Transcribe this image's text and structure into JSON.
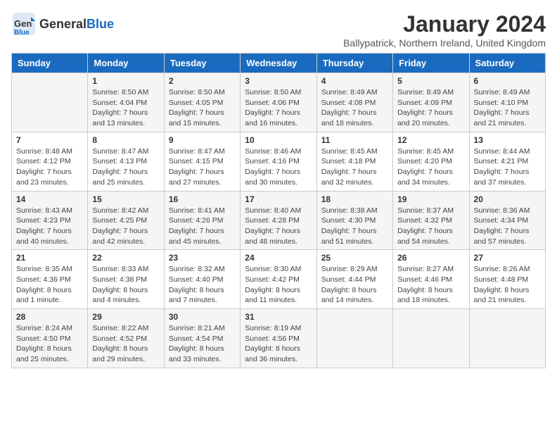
{
  "logo": {
    "general": "General",
    "blue": "Blue"
  },
  "title": "January 2024",
  "subtitle": "Ballypatrick, Northern Ireland, United Kingdom",
  "weekdays": [
    "Sunday",
    "Monday",
    "Tuesday",
    "Wednesday",
    "Thursday",
    "Friday",
    "Saturday"
  ],
  "weeks": [
    [
      {
        "day": null,
        "sunrise": null,
        "sunset": null,
        "daylight": null
      },
      {
        "day": "1",
        "sunrise": "Sunrise: 8:50 AM",
        "sunset": "Sunset: 4:04 PM",
        "daylight": "Daylight: 7 hours and 13 minutes."
      },
      {
        "day": "2",
        "sunrise": "Sunrise: 8:50 AM",
        "sunset": "Sunset: 4:05 PM",
        "daylight": "Daylight: 7 hours and 15 minutes."
      },
      {
        "day": "3",
        "sunrise": "Sunrise: 8:50 AM",
        "sunset": "Sunset: 4:06 PM",
        "daylight": "Daylight: 7 hours and 16 minutes."
      },
      {
        "day": "4",
        "sunrise": "Sunrise: 8:49 AM",
        "sunset": "Sunset: 4:08 PM",
        "daylight": "Daylight: 7 hours and 18 minutes."
      },
      {
        "day": "5",
        "sunrise": "Sunrise: 8:49 AM",
        "sunset": "Sunset: 4:09 PM",
        "daylight": "Daylight: 7 hours and 20 minutes."
      },
      {
        "day": "6",
        "sunrise": "Sunrise: 8:49 AM",
        "sunset": "Sunset: 4:10 PM",
        "daylight": "Daylight: 7 hours and 21 minutes."
      }
    ],
    [
      {
        "day": "7",
        "sunrise": "Sunrise: 8:48 AM",
        "sunset": "Sunset: 4:12 PM",
        "daylight": "Daylight: 7 hours and 23 minutes."
      },
      {
        "day": "8",
        "sunrise": "Sunrise: 8:47 AM",
        "sunset": "Sunset: 4:13 PM",
        "daylight": "Daylight: 7 hours and 25 minutes."
      },
      {
        "day": "9",
        "sunrise": "Sunrise: 8:47 AM",
        "sunset": "Sunset: 4:15 PM",
        "daylight": "Daylight: 7 hours and 27 minutes."
      },
      {
        "day": "10",
        "sunrise": "Sunrise: 8:46 AM",
        "sunset": "Sunset: 4:16 PM",
        "daylight": "Daylight: 7 hours and 30 minutes."
      },
      {
        "day": "11",
        "sunrise": "Sunrise: 8:45 AM",
        "sunset": "Sunset: 4:18 PM",
        "daylight": "Daylight: 7 hours and 32 minutes."
      },
      {
        "day": "12",
        "sunrise": "Sunrise: 8:45 AM",
        "sunset": "Sunset: 4:20 PM",
        "daylight": "Daylight: 7 hours and 34 minutes."
      },
      {
        "day": "13",
        "sunrise": "Sunrise: 8:44 AM",
        "sunset": "Sunset: 4:21 PM",
        "daylight": "Daylight: 7 hours and 37 minutes."
      }
    ],
    [
      {
        "day": "14",
        "sunrise": "Sunrise: 8:43 AM",
        "sunset": "Sunset: 4:23 PM",
        "daylight": "Daylight: 7 hours and 40 minutes."
      },
      {
        "day": "15",
        "sunrise": "Sunrise: 8:42 AM",
        "sunset": "Sunset: 4:25 PM",
        "daylight": "Daylight: 7 hours and 42 minutes."
      },
      {
        "day": "16",
        "sunrise": "Sunrise: 8:41 AM",
        "sunset": "Sunset: 4:26 PM",
        "daylight": "Daylight: 7 hours and 45 minutes."
      },
      {
        "day": "17",
        "sunrise": "Sunrise: 8:40 AM",
        "sunset": "Sunset: 4:28 PM",
        "daylight": "Daylight: 7 hours and 48 minutes."
      },
      {
        "day": "18",
        "sunrise": "Sunrise: 8:38 AM",
        "sunset": "Sunset: 4:30 PM",
        "daylight": "Daylight: 7 hours and 51 minutes."
      },
      {
        "day": "19",
        "sunrise": "Sunrise: 8:37 AM",
        "sunset": "Sunset: 4:32 PM",
        "daylight": "Daylight: 7 hours and 54 minutes."
      },
      {
        "day": "20",
        "sunrise": "Sunrise: 8:36 AM",
        "sunset": "Sunset: 4:34 PM",
        "daylight": "Daylight: 7 hours and 57 minutes."
      }
    ],
    [
      {
        "day": "21",
        "sunrise": "Sunrise: 8:35 AM",
        "sunset": "Sunset: 4:36 PM",
        "daylight": "Daylight: 8 hours and 1 minute."
      },
      {
        "day": "22",
        "sunrise": "Sunrise: 8:33 AM",
        "sunset": "Sunset: 4:38 PM",
        "daylight": "Daylight: 8 hours and 4 minutes."
      },
      {
        "day": "23",
        "sunrise": "Sunrise: 8:32 AM",
        "sunset": "Sunset: 4:40 PM",
        "daylight": "Daylight: 8 hours and 7 minutes."
      },
      {
        "day": "24",
        "sunrise": "Sunrise: 8:30 AM",
        "sunset": "Sunset: 4:42 PM",
        "daylight": "Daylight: 8 hours and 11 minutes."
      },
      {
        "day": "25",
        "sunrise": "Sunrise: 8:29 AM",
        "sunset": "Sunset: 4:44 PM",
        "daylight": "Daylight: 8 hours and 14 minutes."
      },
      {
        "day": "26",
        "sunrise": "Sunrise: 8:27 AM",
        "sunset": "Sunset: 4:46 PM",
        "daylight": "Daylight: 8 hours and 18 minutes."
      },
      {
        "day": "27",
        "sunrise": "Sunrise: 8:26 AM",
        "sunset": "Sunset: 4:48 PM",
        "daylight": "Daylight: 8 hours and 21 minutes."
      }
    ],
    [
      {
        "day": "28",
        "sunrise": "Sunrise: 8:24 AM",
        "sunset": "Sunset: 4:50 PM",
        "daylight": "Daylight: 8 hours and 25 minutes."
      },
      {
        "day": "29",
        "sunrise": "Sunrise: 8:22 AM",
        "sunset": "Sunset: 4:52 PM",
        "daylight": "Daylight: 8 hours and 29 minutes."
      },
      {
        "day": "30",
        "sunrise": "Sunrise: 8:21 AM",
        "sunset": "Sunset: 4:54 PM",
        "daylight": "Daylight: 8 hours and 33 minutes."
      },
      {
        "day": "31",
        "sunrise": "Sunrise: 8:19 AM",
        "sunset": "Sunset: 4:56 PM",
        "daylight": "Daylight: 8 hours and 36 minutes."
      },
      {
        "day": null,
        "sunrise": null,
        "sunset": null,
        "daylight": null
      },
      {
        "day": null,
        "sunrise": null,
        "sunset": null,
        "daylight": null
      },
      {
        "day": null,
        "sunrise": null,
        "sunset": null,
        "daylight": null
      }
    ]
  ]
}
